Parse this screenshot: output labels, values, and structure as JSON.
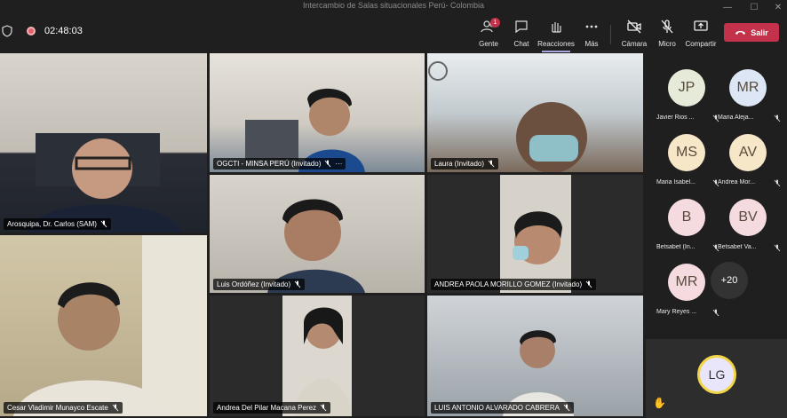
{
  "window": {
    "title": "Intercambio de Salas situacionales Perú- Colombia"
  },
  "toolbar": {
    "timer": "02:48:03",
    "people_label": "Gente",
    "people_badge": "1",
    "chat_label": "Chat",
    "reactions_label": "Reacciones",
    "more_label": "Más",
    "camera_label": "Cámara",
    "mic_label": "Micro",
    "share_label": "Compartir",
    "leave_label": "Salir"
  },
  "colors": {
    "leave": "#c4314b",
    "accent": "#a6a7dc",
    "speaking": "#f2d64a"
  },
  "tiles": [
    {
      "name": "Arosquipa, Dr. Carlos (SAM)"
    },
    {
      "name": "OGCTI - MINSA PERÚ (Invitado)",
      "extra": "···"
    },
    {
      "name": "Laura (Invitado)"
    },
    {
      "name": "Luis Ordóñez (Invitado)"
    },
    {
      "name": "ANDREA PAOLA MORILLO GOMEZ (Invitado)"
    },
    {
      "name": "Cesar Vladimir Munayco Escate"
    },
    {
      "name": "Andrea Del Pilar Macana Perez"
    },
    {
      "name": "LUIS ANTONIO ALVARADO CABRERA"
    }
  ],
  "roster": [
    {
      "initials": "JP",
      "name": "Javier Rios ...",
      "color": "#e6ebd9"
    },
    {
      "initials": "MR",
      "name": "Maria Aleja...",
      "color": "#dde6f5"
    },
    {
      "initials": "MS",
      "name": "Maria Isabel...",
      "color": "#f6e7c8"
    },
    {
      "initials": "AV",
      "name": "Andrea Mor...",
      "color": "#f6e7c8"
    },
    {
      "initials": "B",
      "name": "Betsabet (In...",
      "color": "#f5dbe0"
    },
    {
      "initials": "BV",
      "name": "Betsabet Va...",
      "color": "#f5dbe0"
    },
    {
      "initials": "MR",
      "name": "Mary Reyes ...",
      "color": "#f5dbe0"
    }
  ],
  "more_count": "+20",
  "self": {
    "initials": "LG"
  }
}
